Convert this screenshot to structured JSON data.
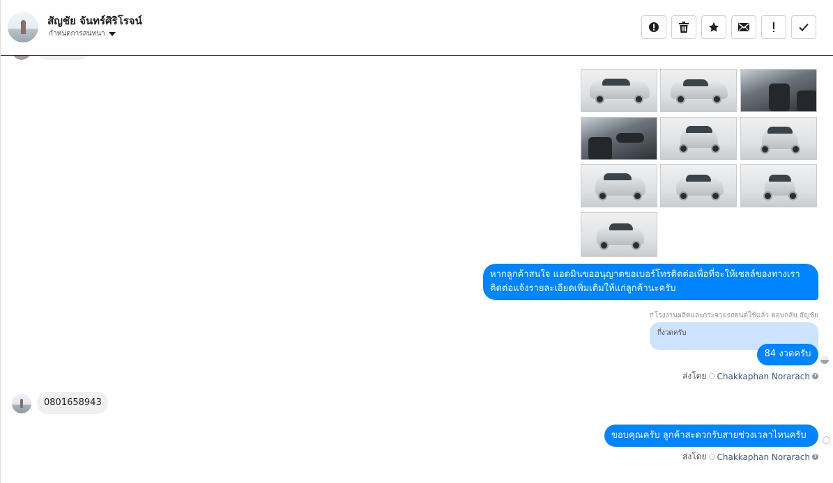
{
  "header": {
    "contact_name": "สัญชัย จันทร์ศิริโรจน์",
    "subtitle": "กำหนดการสนทนา",
    "toolbar": [
      {
        "name": "spam-alert-button",
        "icon": "alert-circle-icon"
      },
      {
        "name": "delete-button",
        "icon": "trash-icon"
      },
      {
        "name": "star-button",
        "icon": "star-icon"
      },
      {
        "name": "mark-unread-button",
        "icon": "envelope-icon"
      },
      {
        "name": "important-button",
        "icon": "exclamation-icon"
      },
      {
        "name": "done-button",
        "icon": "check-icon"
      }
    ]
  },
  "messages": {
    "photo_count": 10,
    "agent_message_1_line1": "หากลูกค้าสนใจ แอดมินขออนุญาตขอเบอร์โทรติดต่อเพื่อที่จะให้เซลล์ของทางเรา",
    "agent_message_1_line2": "ติดต่อแจ้งรายละเอียดเพิ่มเติมให้แก่ลูกค้านะครับ",
    "reply_context": "โรงงานผลิตและกระจายรถยนต์ใช้แล้ว ตอบกลับ สัญชัย",
    "quoted_text": "กี่งวดครับ",
    "agent_message_2": "84 งวดครับ",
    "sent_by_label": "ส่งโดย",
    "sent_by_name": "Chakkaphan Norarach",
    "customer_message": "0801658943",
    "agent_message_3": "ขอบคุณครับ ลูกค้าสะดวกรับสายช่วงเวลาไหนครับ"
  },
  "colors": {
    "bubble_out": "#0084ff",
    "bubble_in": "#f1f0f0",
    "quoted_bg": "#cce4ff",
    "link": "#385898"
  }
}
